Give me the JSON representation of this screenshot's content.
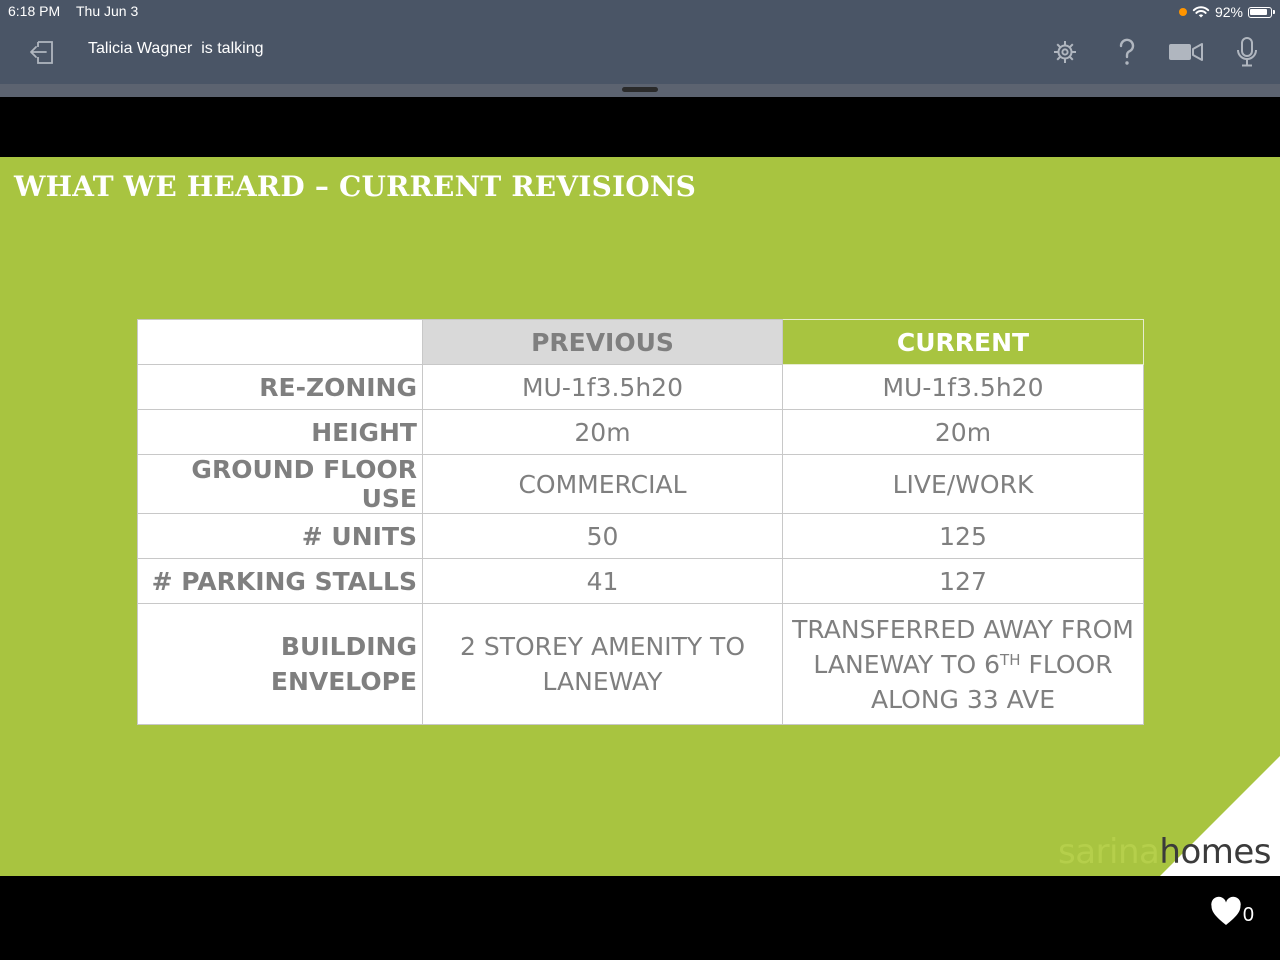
{
  "status_bar": {
    "time": "6:18 PM",
    "date": "Thu Jun 3",
    "battery": "92%",
    "recording_dot_color": "#ff9500"
  },
  "toolbar": {
    "speaker_name": "Talicia Wagner",
    "speaker_status": "is talking",
    "icons": [
      "exit-icon",
      "gear-icon",
      "help-icon",
      "video-camera-icon",
      "microphone-icon"
    ]
  },
  "slide": {
    "title": "WHAT WE HEARD – CURRENT REVISIONS",
    "background": "#a8c440",
    "table": {
      "headers": [
        "",
        "PREVIOUS",
        "CURRENT"
      ],
      "rows": [
        {
          "label": "RE-ZONING",
          "previous": "MU-1f3.5h20",
          "current": "MU-1f3.5h20"
        },
        {
          "label": "HEIGHT",
          "previous": "20m",
          "current": "20m"
        },
        {
          "label": "GROUND FLOOR USE",
          "previous": "COMMERCIAL",
          "current": "LIVE/WORK"
        },
        {
          "label": "# UNITS",
          "previous": "50",
          "current": "125"
        },
        {
          "label": "# PARKING STALLS",
          "previous": "41",
          "current": "127"
        },
        {
          "label": "BUILDING ENVELOPE",
          "previous_lines": [
            "2 STOREY AMENITY TO",
            "LANEWAY"
          ],
          "current_line1": "TRANSFERRED AWAY FROM",
          "current_line2_pre": "LANEWAY TO 6",
          "current_line2_sup": "TH",
          "current_line2_post": " FLOOR",
          "current_line3": "ALONG 33 AVE"
        }
      ]
    },
    "logo": {
      "part1": "sarina",
      "part2": "homes"
    }
  },
  "reactions": {
    "like_count": "0"
  }
}
